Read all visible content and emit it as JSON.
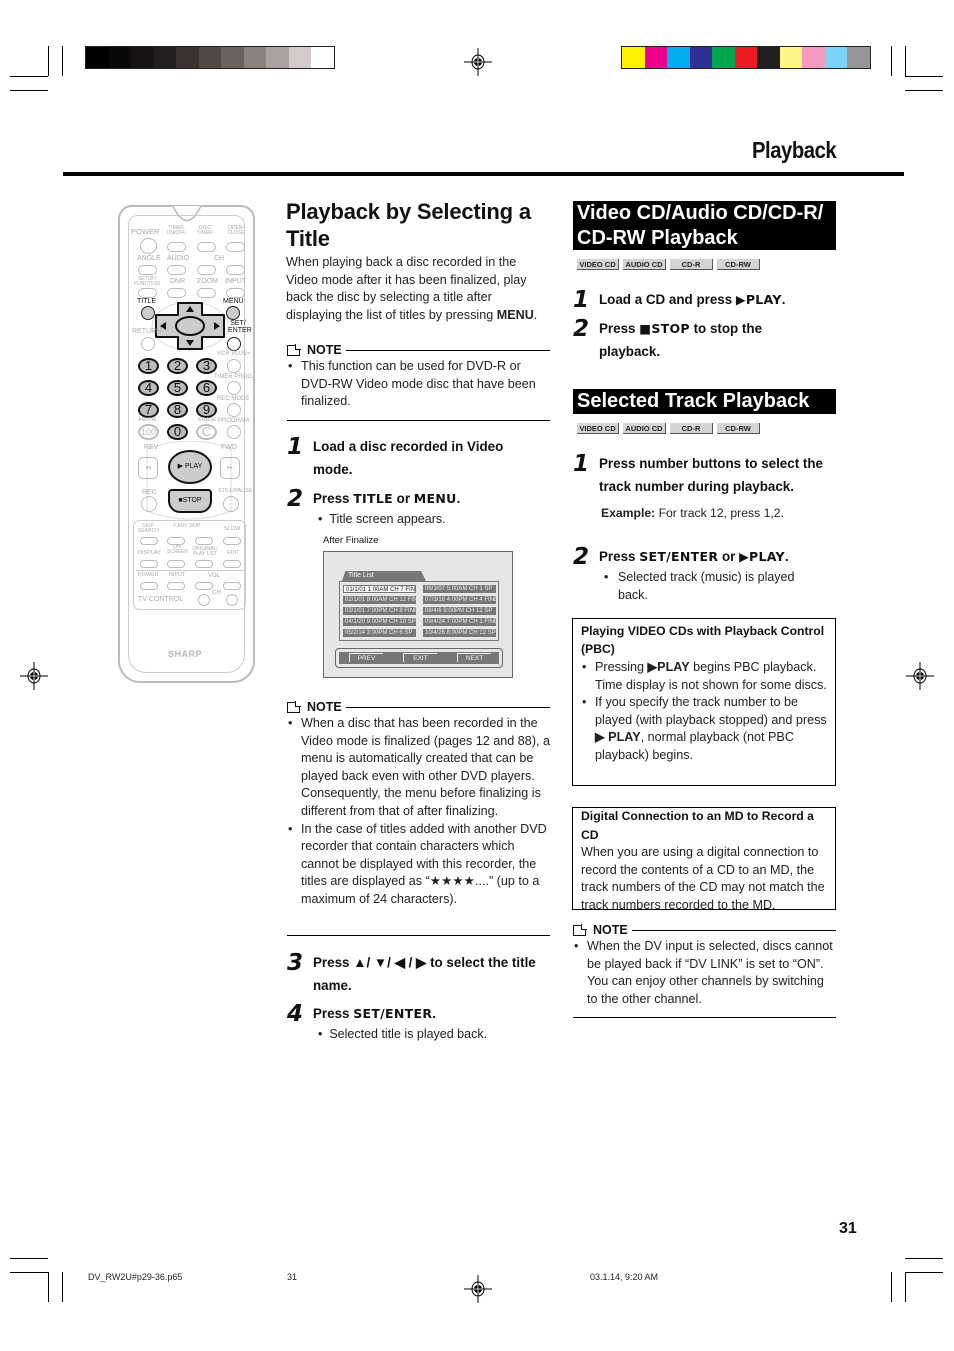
{
  "print_marks": {
    "grayscale_swatches": [
      "#000000",
      "#0a0908",
      "#161312",
      "#231f1e",
      "#3a3130",
      "#524946",
      "#6b625f",
      "#898380",
      "#a8a19f",
      "#d3cbcb",
      "#ffffff"
    ],
    "color_swatches": [
      "#fff200",
      "#ec008c",
      "#00aeef",
      "#2e3192",
      "#00a651",
      "#ed1c24",
      "#231f20",
      "#fff685",
      "#f49ac1",
      "#7dd3f7",
      "#939598"
    ]
  },
  "header": {
    "section_title": "Playback"
  },
  "remote": {
    "brand": "SHARP",
    "labels": {
      "power": "POWER",
      "timer_onoff": "TIMER ON/OFF",
      "disc_timer": "DISC TIMER",
      "open_close": "OPEN/ CLOSE",
      "angle": "ANGLE",
      "audio": "AUDIO",
      "ch": "CH",
      "setup_function": "SETUP/ FUNCTION",
      "dnr": "DNR",
      "zoom": "ZOOM",
      "input": "INPUT",
      "title": "TITLE",
      "menu": "MENU",
      "return": "RETURN",
      "set_enter": "SET/ ENTER",
      "vcr_plus": "VCR PLUS+",
      "timer_prog": "TIMER PROG.",
      "rec_mode": "REC MODE",
      "ampm": "AM/PM",
      "erase": "ERASE",
      "program": "PROGRAM",
      "rev": "REV",
      "fwd": "FWD",
      "play": "PLAY",
      "rec": "REC",
      "still_pause": "STILL/PAUSE",
      "stop": "STOP",
      "skip_search": "SKIP SEARCH",
      "fadv_skip": "F.ADV SKIP",
      "slow": "SLOW",
      "display": "DISPLAY",
      "on_screen": "ON SCREEN",
      "original_playlist": "ORIGINAL/ PLAY LIST",
      "edit": "EDIT",
      "tv_power": "POWER",
      "tv_input": "INPUT",
      "vol": "VOL",
      "tv_control": "TV CONTROL"
    },
    "numbers": [
      "1",
      "2",
      "3",
      "4",
      "5",
      "6",
      "7",
      "8",
      "9",
      "0",
      "100",
      "C"
    ]
  },
  "left_section": {
    "title": "Playback by Selecting a Title",
    "intro": "When playing back a disc recorded in the Video mode after it has been finalized, play back the disc by selecting a title after displaying the list of titles by pressing",
    "intro_key": "MENU",
    "note1": {
      "heading": "NOTE",
      "items": [
        "This function can be used for DVD-R or DVD-RW Video mode disc that have been finalized."
      ]
    },
    "step1": {
      "num": "1",
      "text": "Load a disc recorded in Video mode."
    },
    "step2": {
      "num": "2",
      "prefix": "Press ",
      "key1": "TITLE",
      "mid": " or ",
      "key2": "MENU",
      "suffix": ".",
      "bullet": "Title screen appears."
    },
    "screen": {
      "caption": "After Finalize",
      "tab_label": "Title List",
      "items": [
        "01/1/01  1:00AM  CH  7 FINE",
        "02/1/01  8:00AM  CH 12 FINE",
        "03/1/01  7:00PM  CH  8 FINE",
        "04/1/20  9:00PM  CH 10 SP",
        "05/2/14  3:00PM  CH  6 SP",
        "06/3/07  5:00AM  CH  1 SP",
        "07/3/18  4:00PM  CH  4 FINE",
        "08/4/6    9:00PM  CH 12 SP",
        "09/4/24  7:00PM  CH  1 FINE",
        "10/4/26  8:00PM  CH 12 SP"
      ],
      "selected_index": 0,
      "buttons": [
        "PREV",
        "EXIT",
        "NEXT"
      ]
    },
    "note2": {
      "heading": "NOTE",
      "items": [
        "When a disc that has been recorded in the Video mode is finalized (pages 12 and 88), a menu is automatically created that can be played back even with other DVD players. Consequently, the menu before finalizing is different from that of after finalizing.",
        "In the case of titles added with another DVD recorder that contain characters which cannot be displayed with this recorder, the titles are displayed as “★★★★....” (up to a maximum of 24 characters)."
      ]
    },
    "step3": {
      "num": "3",
      "text": "Press ▲/ ▼/ ◀ / ▶ to select the title name."
    },
    "step4": {
      "num": "4",
      "prefix": "Press ",
      "key": "SET/ENTER",
      "suffix": ".",
      "bullet": "Selected title is played back."
    }
  },
  "right_section": {
    "cd_playback": {
      "title": "Video CD/Audio CD/CD-R/ CD-RW Playback",
      "badges": [
        "VIDEO CD",
        "AUDIO CD",
        "CD-R",
        "CD-RW"
      ],
      "step1": {
        "num": "1",
        "prefix": "Load a CD and press ",
        "key": "▶PLAY",
        "suffix": "."
      },
      "step2": {
        "num": "2",
        "prefix": "Press ",
        "key": "■STOP",
        "suffix": " to stop the playback."
      }
    },
    "track_playback": {
      "title": "Selected Track Playback",
      "badges": [
        "VIDEO CD",
        "AUDIO CD",
        "CD-R",
        "CD-RW"
      ],
      "step1": {
        "num": "1",
        "text": "Press number buttons to select the track number during playback."
      },
      "example_label": "Example:",
      "example_text": " For track 12, press 1,2.",
      "step2": {
        "num": "2",
        "prefix": "Press ",
        "key1": "SET/ENTER",
        "mid": " or ",
        "key2": "▶PLAY",
        "suffix": ".",
        "bullet": "Selected track (music) is played back."
      }
    },
    "pbc_box": {
      "title": "Playing VIDEO CDs with Playback Control (PBC)",
      "items": [
        {
          "pre": "Pressing ",
          "key": "▶PLAY",
          "post": " begins PBC playback. Time display is not shown for some discs."
        },
        {
          "pre": "If you specify the track number to be played (with playback stopped) and press ",
          "key": "▶ PLAY",
          "post": ", normal playback (not PBC playback) begins."
        }
      ]
    },
    "md_box": {
      "title": "Digital Connection to an MD to Record a CD",
      "text": "When you are using a digital connection to record the contents of a CD to an MD, the track numbers of the CD may not match the track numbers recorded to the MD."
    },
    "note3": {
      "heading": "NOTE",
      "items": [
        "When the DV input is selected, discs cannot be played back if “DV LINK” is set to “ON”. You can enjoy other channels by switching to the other channel."
      ]
    }
  },
  "footer": {
    "page_number": "31",
    "file_name": "DV_RW2U#p29-36.p65",
    "file_page": "31",
    "timestamp": "03.1.14, 9:20 AM"
  }
}
